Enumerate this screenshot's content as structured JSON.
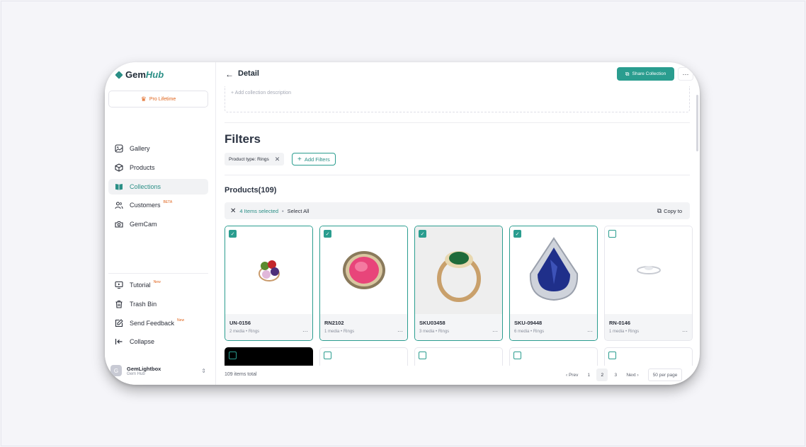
{
  "brand": {
    "name_gem": "Gem",
    "name_hub": "Hub"
  },
  "plan": {
    "label": "Pro Lifetime"
  },
  "nav": {
    "items": [
      {
        "label": "Gallery",
        "icon": "image-icon"
      },
      {
        "label": "Products",
        "icon": "box-icon"
      },
      {
        "label": "Collections",
        "icon": "book-icon",
        "active": true
      },
      {
        "label": "Customers",
        "icon": "users-icon",
        "badge": "BETA"
      },
      {
        "label": "GemCam",
        "icon": "camera-icon"
      }
    ],
    "bottom": [
      {
        "label": "Tutorial",
        "icon": "monitor-play-icon",
        "badge": "New"
      },
      {
        "label": "Trash Bin",
        "icon": "trash-icon"
      },
      {
        "label": "Send Feedback",
        "icon": "feedback-icon",
        "badge": "New"
      },
      {
        "label": "Collapse",
        "icon": "collapse-icon"
      }
    ]
  },
  "account": {
    "avatar": "G",
    "name": "GemLightbox",
    "sub": "Gem Hub"
  },
  "header": {
    "back": "←",
    "title": "Detail",
    "share_label": "Share Collection",
    "more": "···"
  },
  "description": {
    "placeholder": "+ Add collection description"
  },
  "filters": {
    "title": "Filters",
    "chip_label": "Product type: Rings",
    "chip_remove": "✕",
    "add_label": "Add Filters",
    "add_plus": "+"
  },
  "products": {
    "title": "Products(109)",
    "selection": {
      "close": "✕",
      "count": "4 Items selected",
      "separator": "•",
      "select_all": "Select All",
      "copy": "Copy to"
    },
    "cards": [
      {
        "sku": "UN-0156",
        "media": "2 media",
        "type": "Rings",
        "selected": true,
        "gem_color": "#6a3c8e"
      },
      {
        "sku": "RN2102",
        "media": "1 media",
        "type": "Rings",
        "selected": true,
        "gem_color": "#e8457a"
      },
      {
        "sku": "SKU03458",
        "media": "3 media",
        "type": "Rings",
        "selected": true,
        "gem_color": "#1f6b3a"
      },
      {
        "sku": "SKU-09448",
        "media": "6 media",
        "type": "Rings",
        "selected": true,
        "gem_color": "#1f2f8a"
      },
      {
        "sku": "RN-0146",
        "media": "1 media",
        "type": "Rings",
        "selected": false,
        "gem_color": "#d9dbe0"
      }
    ],
    "dot": "•",
    "more": "···"
  },
  "footer": {
    "total": "109 items total",
    "prev": "‹ Prev",
    "pages": [
      "1",
      "2",
      "3"
    ],
    "current_page": "2",
    "next": "Next ›",
    "per_page": "50 per page"
  },
  "colors": {
    "accent": "#2a9d8f",
    "badge": "#e0641c"
  }
}
